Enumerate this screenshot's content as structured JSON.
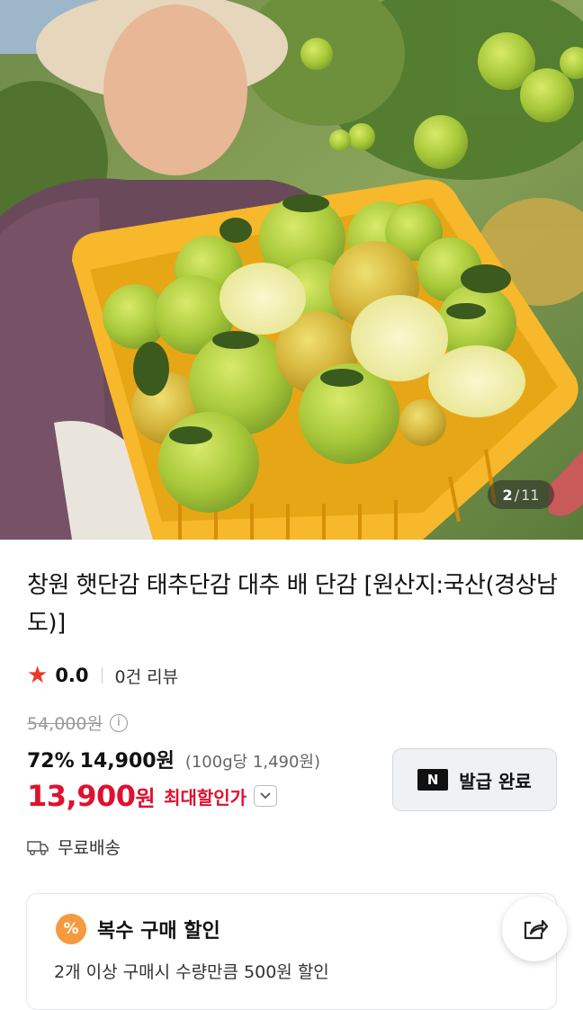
{
  "image": {
    "counter_current": "2",
    "counter_sep": "/",
    "counter_total": "11"
  },
  "product": {
    "title": "창원 햇단감 태추단감 대추 배 단감 [원산지:국산(경상남도)]"
  },
  "rating": {
    "score": "0.0",
    "reviews": "0건 리뷰",
    "star_color": "#e8382a"
  },
  "price": {
    "original": "54,000원",
    "discount_pct": "72%",
    "sale": "14,900원",
    "unit_price": "(100g당 1,490원)",
    "max_price_number": "13,900",
    "max_price_won": "원",
    "max_label": "최대할인가",
    "accent": "#e0102f"
  },
  "coupon": {
    "logo": "N",
    "label": "발급 완료"
  },
  "shipping": {
    "label": "무료배송"
  },
  "multi_discount": {
    "badge": "%",
    "title": "복수 구매 할인",
    "desc": "2개 이상 구매시 수량만큼 500원 할인"
  },
  "icons": {
    "info": "i",
    "chevron": "chevron-down-icon",
    "truck": "truck-icon",
    "share": "share-icon"
  }
}
